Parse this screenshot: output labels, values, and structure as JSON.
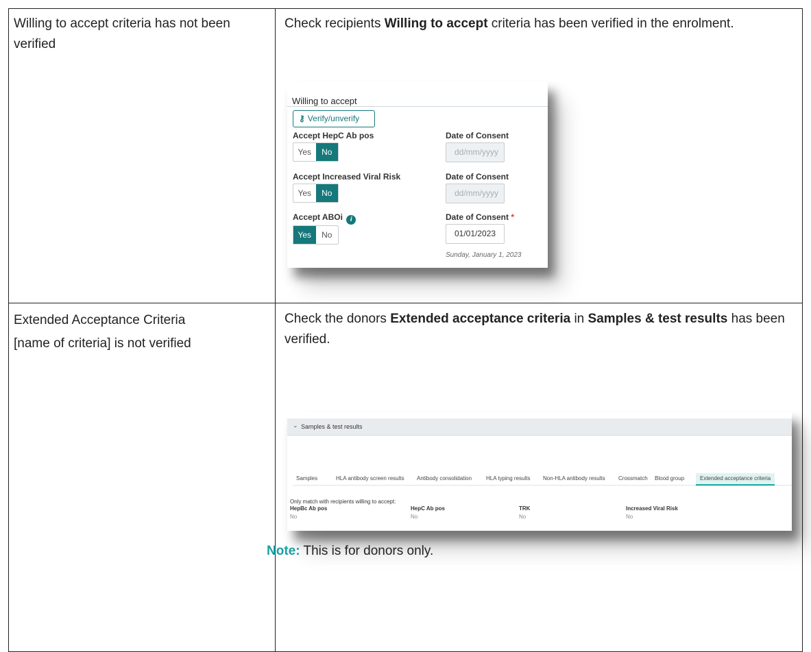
{
  "rows": [
    {
      "issue": "Willing to accept criteria has not been verified",
      "desc_pre": "Check recipients ",
      "desc_bold": "Willing to accept",
      "desc_post": " criteria has been verified in the enrolment."
    },
    {
      "issue_line1": "Extended Acceptance Criteria",
      "issue_line2": "[name of criteria] is not verified",
      "desc_pre": "Check the donors ",
      "desc_bold1": "Extended acceptance criteria",
      "desc_mid": " in ",
      "desc_bold2": "Samples & test results",
      "desc_post": " has been verified."
    }
  ],
  "note": {
    "label": "Note:",
    "text": " This is for donors only."
  },
  "willing_panel": {
    "header": "Willing to accept",
    "verify_button": "Verify/unverify",
    "items": [
      {
        "label": "Accept HepC Ab pos",
        "yes": "Yes",
        "no": "No",
        "selected": "No",
        "date_label": "Date of Consent",
        "date_value": "",
        "date_placeholder": "dd/mm/yyyy"
      },
      {
        "label": "Accept Increased Viral Risk",
        "yes": "Yes",
        "no": "No",
        "selected": "No",
        "date_label": "Date of Consent",
        "date_value": "",
        "date_placeholder": "dd/mm/yyyy"
      },
      {
        "label": "Accept ABOi",
        "yes": "Yes",
        "no": "No",
        "selected": "Yes",
        "date_label": "Date of Consent",
        "date_required": "*",
        "date_value": "01/01/2023",
        "date_hint": "Sunday, January 1, 2023"
      }
    ],
    "accent_color": "#15787a"
  },
  "samples_panel": {
    "section_title": "Samples & test results",
    "tabs": [
      "Samples",
      "HLA antibody screen results",
      "Antibody consolidation",
      "HLA typing results",
      "Non-HLA antibody results",
      "Crossmatch",
      "Blood group",
      "Extended acceptance criteria"
    ],
    "active_tab": "Extended acceptance criteria",
    "subtitle": "Only match with recipients willing to accept:",
    "columns": [
      {
        "header": "HepBc Ab pos",
        "value": "No"
      },
      {
        "header": "HepC Ab pos",
        "value": "No"
      },
      {
        "header": "TRK",
        "value": "No"
      },
      {
        "header": "Increased Viral Risk",
        "value": "No"
      }
    ]
  }
}
